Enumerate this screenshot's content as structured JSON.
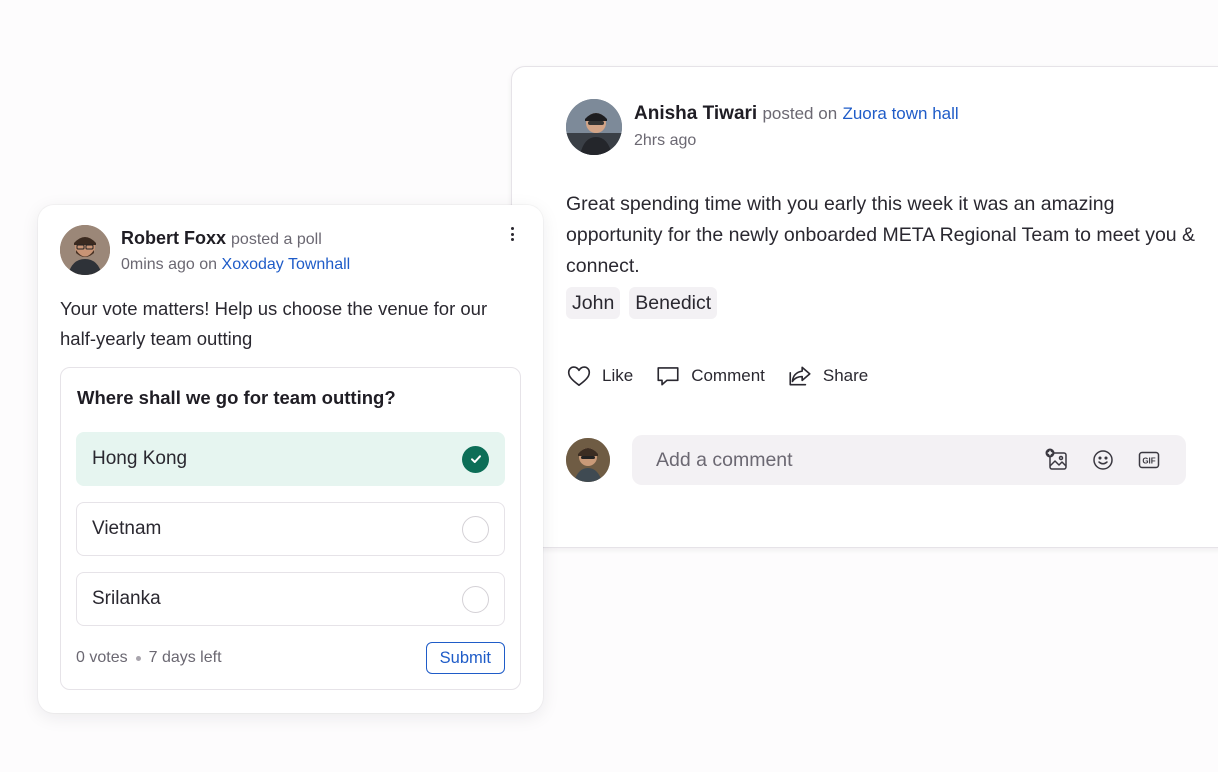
{
  "post": {
    "author": "Anisha Tiwari",
    "posted_on_text": "posted on",
    "group": "Zuora town hall",
    "time": "2hrs ago",
    "body": "Great spending time with you early this week it was an amazing opportunity for the newly onboarded META Regional Team to meet you & connect.",
    "tags": [
      "John",
      "Benedict"
    ],
    "actions": {
      "like": "Like",
      "comment": "Comment",
      "share": "Share"
    },
    "comment_placeholder": "Add a comment",
    "comment_tools": [
      "add-image-icon",
      "emoji-icon",
      "gif-icon"
    ]
  },
  "poll": {
    "author": "Robert Foxx",
    "posted_text": "posted a poll",
    "time": "0mins ago",
    "on_text": "on",
    "group": "Xoxoday Townhall",
    "text": "Your vote matters! Help us choose the venue for our half-yearly team outting",
    "question": "Where shall we go for team outting?",
    "options": [
      {
        "label": "Hong Kong",
        "selected": true
      },
      {
        "label": "Vietnam",
        "selected": false
      },
      {
        "label": "Srilanka",
        "selected": false
      }
    ],
    "votes": "0 votes",
    "days_left": "7 days left",
    "submit_label": "Submit"
  },
  "colors": {
    "link": "#1f5cc8",
    "selected_bg": "#e6f5f0",
    "check": "#0c6e57"
  }
}
